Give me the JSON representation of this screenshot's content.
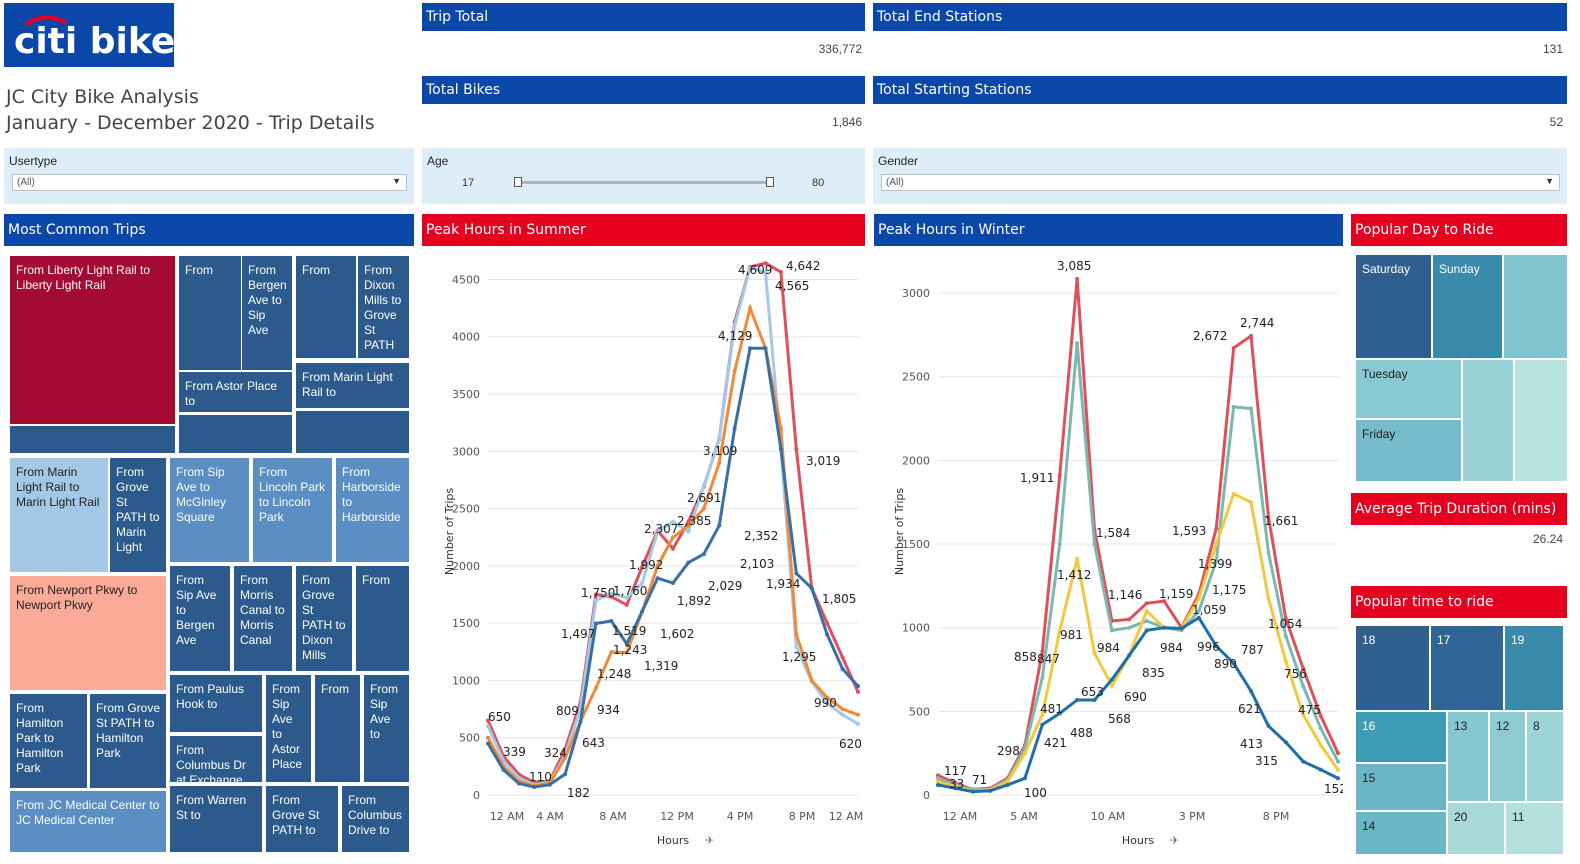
{
  "logo": {
    "text": "citi bike"
  },
  "title": {
    "line1": "JC City Bike Analysis",
    "line2": "January - December 2020 - Trip Details"
  },
  "kpis": [
    {
      "label": "Trip Total",
      "value": "336,772"
    },
    {
      "label": "Total End Stations",
      "value": "131"
    },
    {
      "label": "Total Bikes",
      "value": "1,846"
    },
    {
      "label": "Total Starting Stations",
      "value": "52"
    }
  ],
  "filters": {
    "usertype": {
      "label": "Usertype",
      "value": "(All)"
    },
    "age": {
      "label": "Age",
      "min": "17",
      "max": "80"
    },
    "gender": {
      "label": "Gender",
      "value": "(All)"
    }
  },
  "sections": {
    "common_trips": "Most Common Trips",
    "summer": "Peak Hours in Summer",
    "winter": "Peak Hours in Winter",
    "popular_day": "Popular Day to Ride",
    "avg_duration": "Average Trip Duration (mins)",
    "avg_duration_value": "26.24",
    "popular_time": "Popular time to ride"
  },
  "trips": [
    {
      "label": "From Liberty Light Rail to Liberty Light Rail",
      "color": "#a30b35"
    },
    {
      "label": "From",
      "color": "#2c5a8c"
    },
    {
      "label": "From Bergen Ave to Sip Ave",
      "color": "#2c5a8c"
    },
    {
      "label": "From",
      "color": "#2c5a8c"
    },
    {
      "label": "From Dixon Mills to Grove St PATH",
      "color": "#2c5a8c"
    },
    {
      "label": "From Astor Place to",
      "color": "#2c5a8c"
    },
    {
      "label": "From Marin Light Rail to",
      "color": "#2c5a8c"
    },
    {
      "label": "From Marin Light Rail to Marin Light Rail",
      "color": "#a4c9e8"
    },
    {
      "label": "From Grove St PATH to Marin Light",
      "color": "#2c5a8c"
    },
    {
      "label": "From Sip Ave to McGinley Square",
      "color": "#5b8fc4"
    },
    {
      "label": "From Lincoln Park to Lincoln Park",
      "color": "#5b8fc4"
    },
    {
      "label": "From Harborside to Harborside",
      "color": "#5b8fc4"
    },
    {
      "label": "From Newport Pkwy to Newport Pkwy",
      "color": "#fcaa98"
    },
    {
      "label": "From Sip Ave to Bergen Ave",
      "color": "#2c5a8c"
    },
    {
      "label": "From Morris Canal to Morris Canal",
      "color": "#2c5a8c"
    },
    {
      "label": "From Grove St PATH to Dixon Mills",
      "color": "#2c5a8c"
    },
    {
      "label": "From",
      "color": "#2c5a8c"
    },
    {
      "label": "From Hamilton Park to Hamilton Park",
      "color": "#2c5a8c"
    },
    {
      "label": "From Grove St PATH to Hamilton Park",
      "color": "#2c5a8c"
    },
    {
      "label": "From Paulus Hook to",
      "color": "#2c5a8c"
    },
    {
      "label": "From Sip Ave to Astor Place",
      "color": "#2c5a8c"
    },
    {
      "label": "From",
      "color": "#2c5a8c"
    },
    {
      "label": "From Sip Ave to",
      "color": "#2c5a8c"
    },
    {
      "label": "From Columbus Dr at Exchange",
      "color": "#2c5a8c"
    },
    {
      "label": "From JC Medical Center to JC Medical Center",
      "color": "#5b8fc4"
    },
    {
      "label": "From Warren St to",
      "color": "#2c5a8c"
    },
    {
      "label": "From Grove St PATH to",
      "color": "#2c5a8c"
    },
    {
      "label": "From Columbus Drive to",
      "color": "#2c5a8c"
    }
  ],
  "days": [
    {
      "label": "Saturday",
      "color": "#2f5f8f"
    },
    {
      "label": "Sunday",
      "color": "#3a8aab"
    },
    {
      "label": "",
      "color": "#82c4cf"
    },
    {
      "label": "Tuesday",
      "color": "#88c9d2"
    },
    {
      "label": "",
      "color": "#99d3d6"
    },
    {
      "label": "",
      "color": "#b9e3df"
    },
    {
      "label": "Friday",
      "color": "#77bccc"
    }
  ],
  "hours_tiles": [
    {
      "label": "18",
      "color": "#2f5f8f"
    },
    {
      "label": "17",
      "color": "#2f6696"
    },
    {
      "label": "19",
      "color": "#3a8aab"
    },
    {
      "label": "16",
      "color": "#3f9cb6"
    },
    {
      "label": "13",
      "color": "#86c8d1"
    },
    {
      "label": "12",
      "color": "#8dcbd2"
    },
    {
      "label": "8",
      "color": "#9dd5d7"
    },
    {
      "label": "15",
      "color": "#6ab6c8"
    },
    {
      "label": "14",
      "color": "#6ab6c8"
    },
    {
      "label": "20",
      "color": "#a8d9d8"
    },
    {
      "label": "11",
      "color": "#b3e0dc"
    }
  ],
  "chart_data": [
    {
      "type": "line",
      "title": "Peak Hours in Summer",
      "xlabel": "Hours",
      "ylabel": "Number of Trips",
      "x_ticks": [
        "12 AM",
        "4 AM",
        "8 AM",
        "12 PM",
        "4 PM",
        "8 PM",
        "12 AM"
      ],
      "y_ticks": [
        "0",
        "500",
        "1000",
        "1500",
        "2000",
        "2500",
        "3000",
        "3500",
        "4000",
        "4500"
      ],
      "ylim": [
        0,
        4600
      ],
      "x": [
        0,
        1,
        2,
        3,
        4,
        5,
        6,
        7,
        8,
        9,
        10,
        11,
        12,
        13,
        14,
        15,
        16,
        17,
        18,
        19,
        20,
        21,
        22,
        23,
        24
      ],
      "series": [
        {
          "color": "#e0505a",
          "values": [
            650,
            339,
            180,
            110,
            120,
            400,
            809,
            1750,
            1730,
            1660,
            1992,
            2307,
            2150,
            2385,
            2691,
            3109,
            4129,
            4609,
            4642,
            4565,
            3019,
            1805,
            1500,
            1200,
            900
          ]
        },
        {
          "color": "#a4c9e8",
          "values": [
            600,
            300,
            150,
            90,
            110,
            350,
            760,
            1700,
            1760,
            1720,
            1850,
            2300,
            2385,
            2300,
            2700,
            3100,
            4100,
            4600,
            4565,
            3019,
            1295,
            990,
            800,
            700,
            620
          ]
        },
        {
          "color": "#f08a3a",
          "values": [
            500,
            250,
            120,
            80,
            100,
            324,
            643,
            934,
            1248,
            1243,
            1602,
            2000,
            2250,
            2350,
            2500,
            2900,
            3700,
            4250,
            3900,
            3200,
            1400,
            1000,
            850,
            750,
            700
          ]
        },
        {
          "color": "#3a6fa5",
          "values": [
            450,
            220,
            100,
            70,
            90,
            182,
            640,
            1497,
            1519,
            1319,
            1602,
            1892,
            1850,
            2029,
            2103,
            2352,
            3200,
            3900,
            3900,
            3019,
            1934,
            1805,
            1400,
            1100,
            950
          ]
        }
      ],
      "labels": [
        "4,609",
        "4,642",
        "4,565",
        "4,129",
        "3,109",
        "3,019",
        "2,691",
        "2,385",
        "2,307",
        "2,352",
        "2,103",
        "2,029",
        "1,992",
        "1,934",
        "1,892",
        "1,805",
        "1,750",
        "1,760",
        "1,602",
        "1,519",
        "1,497",
        "1,319",
        "1,295",
        "1,248",
        "1,243",
        "990",
        "934",
        "809",
        "650",
        "643",
        "620",
        "339",
        "324",
        "182",
        "110"
      ]
    },
    {
      "type": "line",
      "title": "Peak Hours in Winter",
      "xlabel": "Hours",
      "ylabel": "Number of Trips",
      "x_ticks": [
        "12 AM",
        "5 AM",
        "10 AM",
        "3 PM",
        "8 PM"
      ],
      "y_ticks": [
        "0",
        "500",
        "1000",
        "1500",
        "2000",
        "2500",
        "3000"
      ],
      "ylim": [
        0,
        3150
      ],
      "x": [
        0,
        1,
        2,
        3,
        4,
        5,
        6,
        7,
        8,
        9,
        10,
        11,
        12,
        13,
        14,
        15,
        16,
        17,
        18,
        19,
        20,
        21,
        22,
        23
      ],
      "series": [
        {
          "color": "#e0505a",
          "values": [
            117,
            71,
            33,
            40,
            100,
            298,
            858,
            1911,
            3085,
            1584,
            1040,
            1050,
            1146,
            1159,
            1000,
            1200,
            1593,
            2672,
            2744,
            1661,
            1054,
            756,
            475,
            250
          ]
        },
        {
          "color": "#7bb8b0",
          "values": [
            100,
            60,
            30,
            35,
            90,
            280,
            700,
            1500,
            2700,
            1500,
            984,
            1000,
            1040,
            1000,
            984,
            1100,
            1399,
            2320,
            2310,
            1450,
            950,
            650,
            400,
            200
          ]
        },
        {
          "color": "#f2c93e",
          "values": [
            80,
            50,
            25,
            30,
            80,
            250,
            481,
            981,
            1412,
            847,
            653,
            835,
            1100,
            1000,
            996,
            1175,
            1500,
            1800,
            1750,
            1175,
            800,
            480,
            300,
            150
          ]
        },
        {
          "color": "#1f6eaa",
          "values": [
            60,
            40,
            20,
            25,
            60,
            100,
            421,
            488,
            568,
            568,
            690,
            835,
            984,
            1000,
            996,
            1059,
            890,
            787,
            621,
            413,
            315,
            200,
            152,
            100
          ]
        }
      ],
      "labels": [
        "3,085",
        "2,744",
        "2,672",
        "1,911",
        "1,661",
        "1,593",
        "1,584",
        "1,412",
        "1,399",
        "1,175",
        "1,159",
        "1,146",
        "1,059",
        "1,054",
        "996",
        "984",
        "984",
        "981",
        "890",
        "858",
        "847",
        "835",
        "787",
        "756",
        "690",
        "653",
        "621",
        "568",
        "488",
        "481",
        "475",
        "421",
        "413",
        "315",
        "298",
        "152",
        "117",
        "100",
        "71",
        "33"
      ]
    }
  ]
}
